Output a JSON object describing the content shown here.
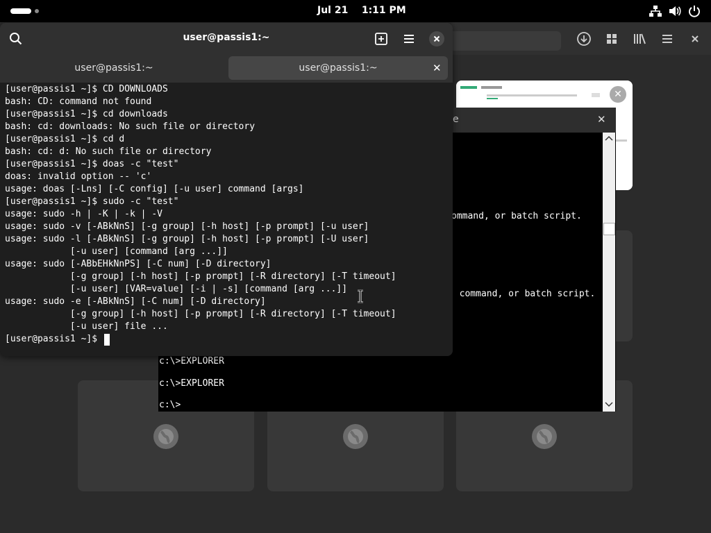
{
  "topbar": {
    "clock_date": "Jul 21",
    "clock_time": "1:11 PM",
    "icons": [
      "network-icon",
      "volume-icon",
      "power-icon"
    ]
  },
  "terminal": {
    "title": "user@passis1:~",
    "tabs": [
      {
        "label": "user@passis1:~",
        "active": false
      },
      {
        "label": "user@passis1:~",
        "active": true
      }
    ],
    "lines": [
      "[user@passis1 ~]$ CD DOWNLOADS",
      "bash: CD: command not found",
      "[user@passis1 ~]$ cd downloads",
      "bash: cd: downloads: No such file or directory",
      "[user@passis1 ~]$ cd d",
      "bash: cd: d: No such file or directory",
      "[user@passis1 ~]$ doas -c \"test\"",
      "doas: invalid option -- 'c'",
      "usage: doas [-Lns] [-C config] [-u user] command [args]",
      "[user@passis1 ~]$ sudo -c \"test\"",
      "usage: sudo -h | -K | -k | -V",
      "usage: sudo -v [-ABkNnS] [-g group] [-h host] [-p prompt] [-u user]",
      "usage: sudo -l [-ABkNnS] [-g group] [-h host] [-p prompt] [-U user]",
      "            [-u user] [command [arg ...]]",
      "usage: sudo [-ABbEHkNnPS] [-C num] [-D directory]",
      "            [-g group] [-h host] [-p prompt] [-R directory] [-T timeout]",
      "            [-u user] [VAR=value] [-i | -s] [command [arg ...]]",
      "usage: sudo -e [-ABkNnS] [-C num] [-D directory]",
      "            [-g group] [-h host] [-p prompt] [-R directory] [-T timeout]",
      "            [-u user] file ...",
      "[user@passis1 ~]$ "
    ]
  },
  "cmd_window": {
    "title_fragment": "e",
    "lines": [
      {
        "text": "ommand, or batch script.",
        "col": "right1"
      },
      {
        "text": ". command, or batch script.",
        "col": "right2"
      },
      {
        "text": "c:\\>EXPLORER",
        "col": "bottom1"
      },
      {
        "text": "c:\\>EXPLORER",
        "col": "bottom2"
      },
      {
        "text": "c:\\>",
        "col": "bottom3"
      }
    ]
  },
  "colors": {
    "topbar": "#000000",
    "terminal_bg": "#1e1e1e",
    "header_bg": "#303030",
    "desktop_bg": "#2b2b2b"
  }
}
